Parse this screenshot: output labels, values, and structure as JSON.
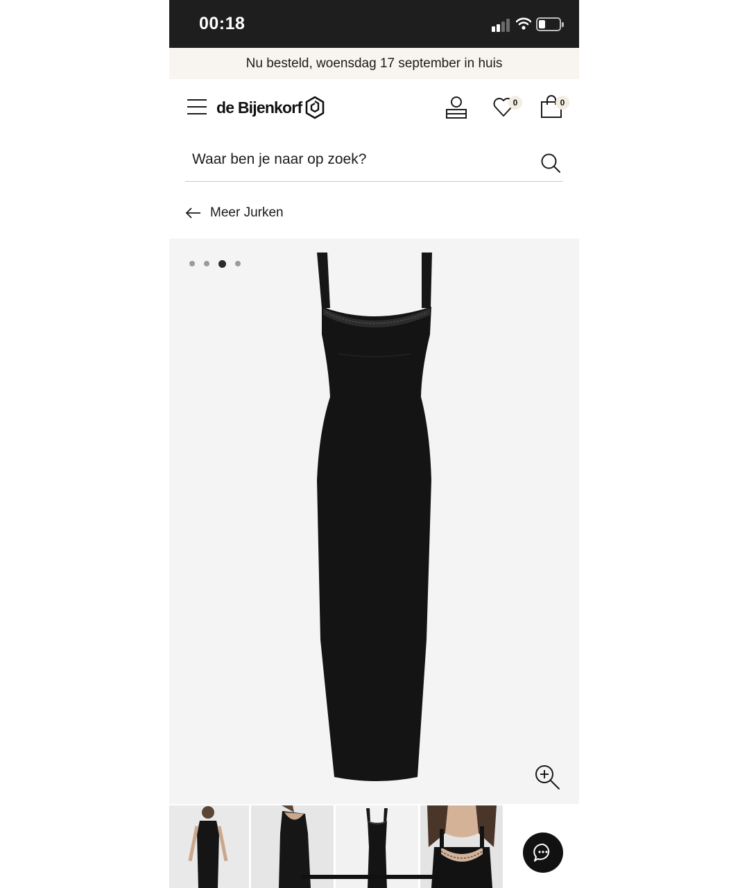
{
  "status_bar": {
    "time": "00:18",
    "icons": [
      "cellular-signal-icon",
      "wifi-icon",
      "battery-icon"
    ]
  },
  "banner": {
    "text": "Nu besteld, woensdag 17 september in huis"
  },
  "header": {
    "logo_text": "de Bijenkorf",
    "icons": [
      "hamburger-menu-icon",
      "account-icon",
      "heart-icon",
      "shopping-bag-icon"
    ],
    "wishlist_count": "0",
    "bag_count": "0"
  },
  "search": {
    "placeholder": "Waar ben je naar op zoek?"
  },
  "back_link": {
    "label": "Meer Jurken"
  },
  "gallery": {
    "slide_count": 4,
    "active_slide": 3,
    "image": "black-lace-trim-maxi-dress"
  },
  "thumbnails": [
    "model-front-view",
    "model-back-view",
    "product-flat-view",
    "model-neckline-closeup"
  ],
  "colors": {
    "status_bar_bg": "#1e1e1e",
    "banner_bg": "#f8f5f0",
    "gallery_bg": "#f4f4f4",
    "badge_bg": "#f3ece1",
    "chat_bg": "#111111"
  }
}
